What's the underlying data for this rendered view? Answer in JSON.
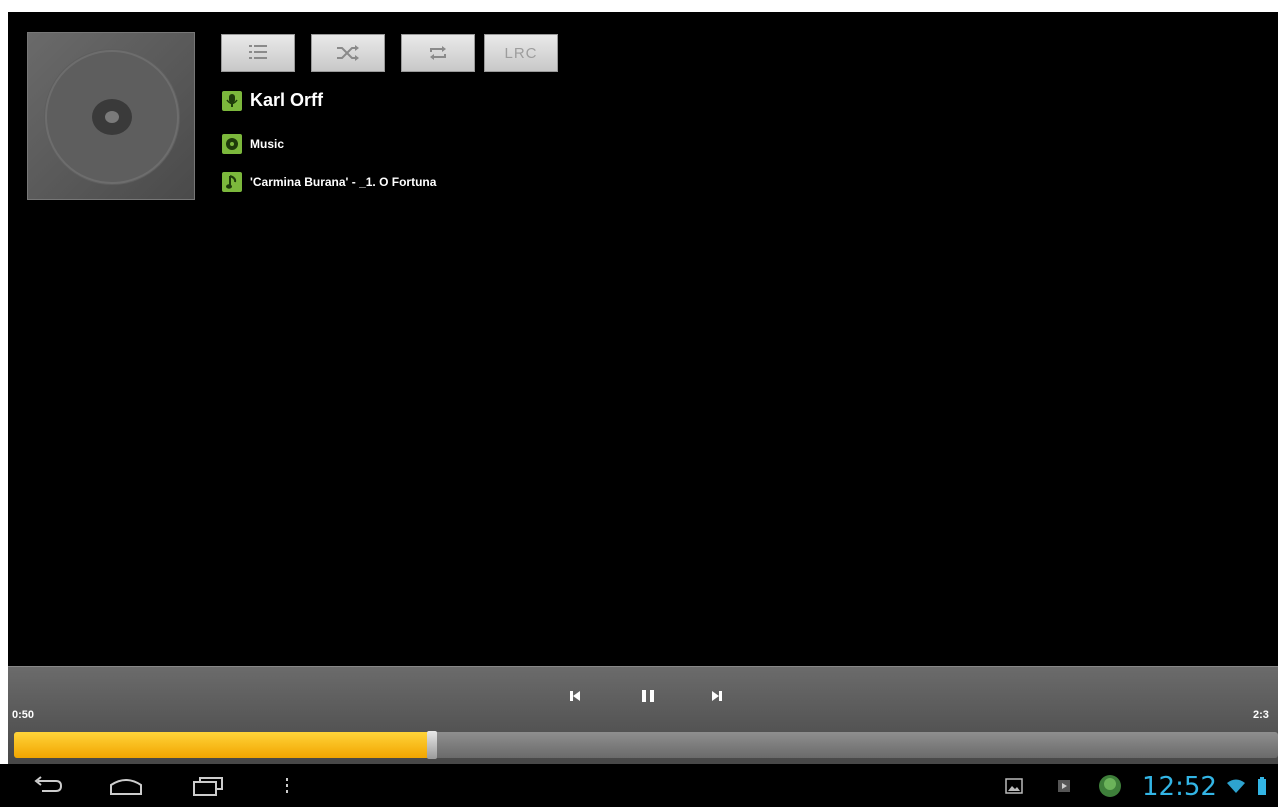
{
  "toolbar": {
    "playlist_icon": "playlist-icon",
    "shuffle_icon": "shuffle-icon",
    "repeat_icon": "repeat-icon",
    "lrc_label": "LRC"
  },
  "track_info": {
    "artist": "Karl Orff",
    "album": "Music",
    "title": "'Carmina Burana' - _1. O Fortuna"
  },
  "player": {
    "elapsed": "0:50",
    "total": "2:3",
    "progress": 0.33,
    "accent_color": "#f7b500"
  },
  "status": {
    "clock": "12:52",
    "accent_color": "#33b5e5"
  }
}
